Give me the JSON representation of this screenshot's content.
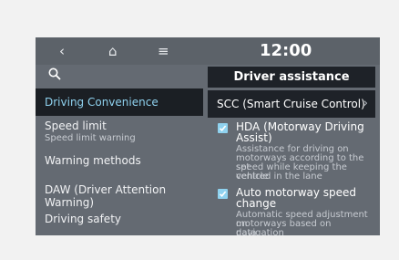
{
  "topbar": {
    "back_icon": "‹",
    "home_icon": "⌂",
    "menu_icon": "≡",
    "clock": "12:00"
  },
  "left_menu": {
    "selected": "Driving Convenience",
    "items": [
      {
        "label": "Speed limit",
        "sublabel": "Speed limit warning"
      },
      {
        "label": "Warning methods"
      },
      {
        "label": "DAW (Driver Attention Warning)"
      },
      {
        "label": "Driving safety"
      }
    ]
  },
  "panel": {
    "title": "Driver assistance",
    "scc_label": "SCC (Smart Cruise Control)",
    "scc_chevron": "›",
    "options": [
      {
        "title_line1": "HDA (Motorway Driving",
        "title_line2": "Assist)",
        "desc_line1": "Assistance for driving on",
        "desc_line2": "motorways according to the set",
        "desc_line3": "speed while keeping the vehicle",
        "desc_line4": "centred in the lane",
        "checked": true
      },
      {
        "title_line1": "Auto motorway speed",
        "title_line2": "change",
        "desc_line1": "Automatic speed adjustment on",
        "desc_line2": "motorways based on navigation",
        "desc_line3": "data",
        "checked": true
      }
    ]
  },
  "colors": {
    "screen_bg": "#646a72",
    "selected_bg": "#1b1f24",
    "accent": "#8fd2ef"
  }
}
